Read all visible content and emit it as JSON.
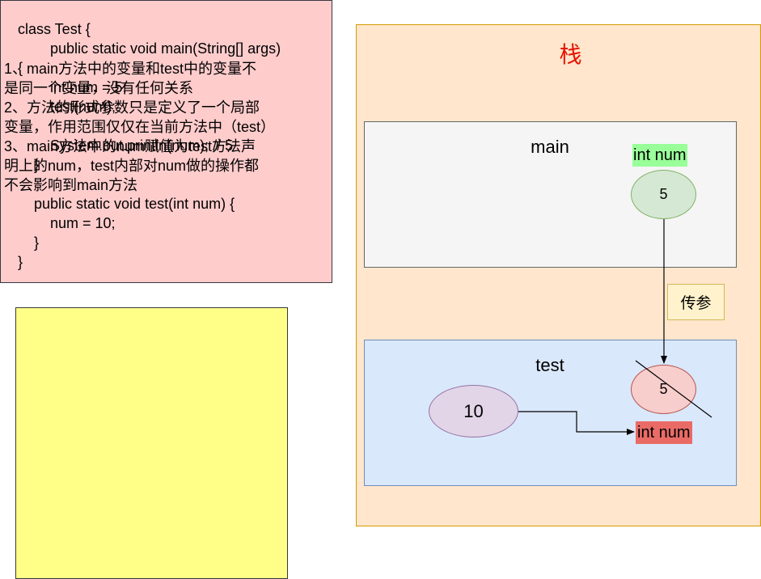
{
  "code": {
    "lines": [
      "class Test {",
      "        public static void main(String[] args)",
      "{",
      "        int num = 5;",
      "        test(num);",
      "",
      "        System.out.println(num); // 5",
      "    }",
      "",
      "    public static void test(int num) {",
      "        num = 10;",
      "    }",
      "}"
    ]
  },
  "notes": {
    "items": [
      "1、main方法中的变量和test中的变量不是同一个变量，没有任何关系",
      "2、方法的形式参数只是定义了一个局部变量，作用范围仅仅在当前方法中（test）",
      "3、main方法中的num赋值为test方法声明上的num，test内部对num做的操作都不会影响到main方法"
    ]
  },
  "stack": {
    "title": "栈",
    "main": {
      "title": "main",
      "var_label": "int num",
      "value": "5"
    },
    "pass_label": "传参",
    "test": {
      "title": "test",
      "param_value": "5",
      "new_value": "10",
      "var_label": "int num"
    }
  },
  "colors": {
    "code_bg": "#ffcccc",
    "note_bg": "#ffff88",
    "stack_bg": "#ffe6cc",
    "stack_title": "#e51400",
    "main_frame_bg": "#f5f5f5",
    "test_frame_bg": "#dae8fc",
    "main_var_highlight": "#99ff99",
    "test_var_highlight": "#ea6b66"
  }
}
